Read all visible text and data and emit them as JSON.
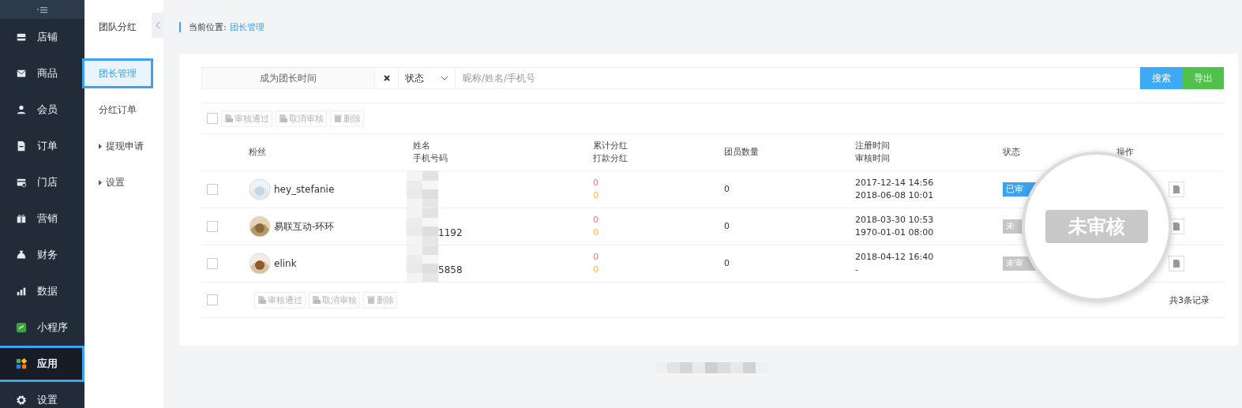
{
  "sidebar": {
    "items": [
      {
        "label": "店铺",
        "selected": false
      },
      {
        "label": "商品",
        "selected": false
      },
      {
        "label": "会员",
        "selected": false
      },
      {
        "label": "订单",
        "selected": false
      },
      {
        "label": "门店",
        "selected": false
      },
      {
        "label": "营销",
        "selected": false
      },
      {
        "label": "财务",
        "selected": false
      },
      {
        "label": "数据",
        "selected": false
      },
      {
        "label": "小程序",
        "selected": false
      },
      {
        "label": "应用",
        "selected": true
      },
      {
        "label": "设置",
        "selected": false
      }
    ]
  },
  "subnav": {
    "title": "团队分红",
    "items": [
      {
        "label": "团长管理",
        "selected": true,
        "expandable": false
      },
      {
        "label": "分红订单",
        "selected": false,
        "expandable": false
      },
      {
        "label": "提现申请",
        "selected": false,
        "expandable": true
      },
      {
        "label": "设置",
        "selected": false,
        "expandable": true
      }
    ]
  },
  "breadcrumb": {
    "label": "当前位置:",
    "current": "团长管理"
  },
  "filter": {
    "date_placeholder": "成为团长时间",
    "status_select": "状态",
    "search_placeholder": "昵称/姓名/手机号",
    "buttons": [
      {
        "label": "搜索",
        "kind": "primary"
      },
      {
        "label": "导出",
        "kind": "success"
      }
    ]
  },
  "bulk_actions_top": {
    "checked": false,
    "buttons": [
      "审核通过",
      "取消审核",
      "删除"
    ]
  },
  "table": {
    "columns": [
      [
        "粉丝"
      ],
      [
        "姓名",
        "手机号码"
      ],
      [
        "累计分红",
        "打款分红"
      ],
      [
        "团员数量"
      ],
      [
        "注册时间",
        "审核时间"
      ],
      [
        "状态"
      ],
      [
        "操作"
      ]
    ],
    "rows": [
      {
        "checked": false,
        "nickname": "hey_stefanie",
        "phone": "",
        "cumulative": "0",
        "paid": "0",
        "members": "0",
        "registered": "2017-12-14 14:56",
        "reviewed": "2018-06-08 10:01",
        "status": {
          "label": "已审",
          "kind": "approved"
        }
      },
      {
        "checked": false,
        "nickname": "易联互动-环环",
        "phone": "1192",
        "cumulative": "0",
        "paid": "0",
        "members": "0",
        "registered": "2018-03-30 10:53",
        "reviewed": "1970-01-01 08:00",
        "status": {
          "label": "未",
          "kind": "pending"
        }
      },
      {
        "checked": false,
        "nickname": "elink",
        "phone": "5858",
        "cumulative": "0",
        "paid": "0",
        "members": "0",
        "registered": "2018-04-12 16:40",
        "reviewed": "-",
        "status": {
          "label": "未审",
          "kind": "pending"
        }
      }
    ]
  },
  "bulk_actions_bottom": {
    "checked": false,
    "buttons": [
      "审核通过",
      "取消审核",
      "删除"
    ]
  },
  "total": "共3条记录",
  "magnifier": {
    "label": "未审核",
    "kind": "pending"
  }
}
